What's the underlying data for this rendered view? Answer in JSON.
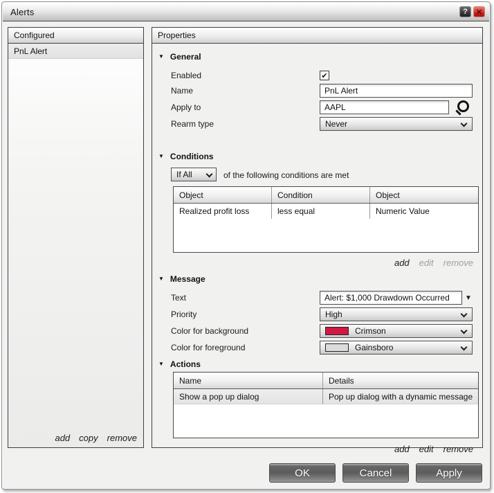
{
  "window": {
    "title": "Alerts"
  },
  "icons": {
    "help": "?",
    "close": "✕",
    "section_collapse": "▼",
    "combo_arrow": "▼",
    "check": "✔"
  },
  "configured": {
    "header": "Configured",
    "items": [
      {
        "label": "PnL Alert"
      }
    ],
    "links": {
      "add": "add",
      "copy": "copy",
      "remove": "remove"
    }
  },
  "properties": {
    "header": "Properties",
    "general": {
      "title": "General",
      "enabled_label": "Enabled",
      "name_label": "Name",
      "name_value": "PnL Alert",
      "apply_to_label": "Apply to",
      "apply_to_value": "AAPL",
      "rearm_label": "Rearm type",
      "rearm_value": "Never"
    },
    "conditions": {
      "title": "Conditions",
      "match_value": "If All",
      "match_text": "of the following conditions are met",
      "headers": [
        "Object",
        "Condition",
        "Object"
      ],
      "rows": [
        [
          "Realized profit loss",
          "less equal",
          "Numeric Value"
        ]
      ],
      "links": {
        "add": "add",
        "edit": "edit",
        "remove": "remove"
      }
    },
    "message": {
      "title": "Message",
      "text_label": "Text",
      "text_value": "Alert: $1,000 Drawdown Occurred",
      "priority_label": "Priority",
      "priority_value": "High",
      "background_label": "Color for background",
      "background_value": "Crimson",
      "background_color": "#D31745",
      "foreground_label": "Color for foreground",
      "foreground_value": "Gainsboro",
      "foreground_color": "#DCDCDC"
    },
    "actions": {
      "title": "Actions",
      "headers": [
        "Name",
        "Details"
      ],
      "rows": [
        [
          "Show a pop up dialog",
          "Pop up dialog with a dynamic message"
        ]
      ],
      "links": {
        "add": "add",
        "edit": "edit",
        "remove": "remove"
      }
    }
  },
  "footer": {
    "ok": "OK",
    "cancel": "Cancel",
    "apply": "Apply"
  }
}
